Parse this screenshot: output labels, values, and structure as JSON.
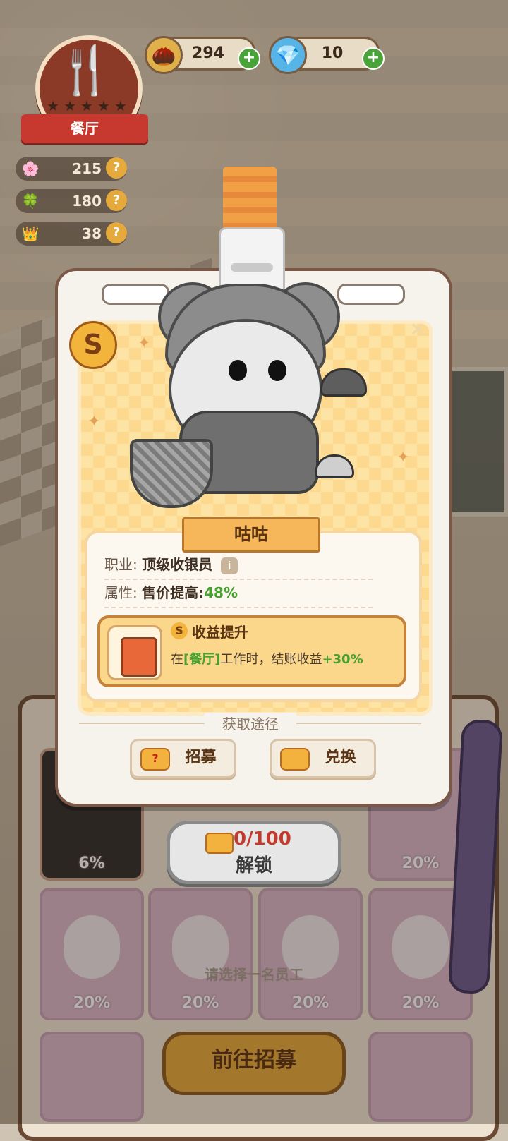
{
  "hud": {
    "building": {
      "label": "餐厅"
    },
    "coins": {
      "value": "294"
    },
    "gems": {
      "value": "10"
    },
    "stats": [
      {
        "icon": "flower-icon",
        "value": "215"
      },
      {
        "icon": "clover-icon",
        "value": "180"
      },
      {
        "icon": "crown-icon",
        "value": "38"
      }
    ],
    "question_mark": "?",
    "plus": "+"
  },
  "card": {
    "grade": "S",
    "close_glyph": "×",
    "name": "咕咕",
    "job_label": "职业:",
    "job_value": "顶级收银员",
    "info_glyph": "i",
    "attr_label": "属性:",
    "attr_value": "售价提高:",
    "attr_pct": "48%",
    "skill": {
      "badge": "S",
      "title": "收益提升",
      "desc_prefix": "在",
      "desc_place": "[餐厅]",
      "desc_mid": "工作时，结账收益",
      "desc_bonus": "+30%"
    },
    "acquire_title": "获取途径",
    "recruit_label": "招募",
    "exchange_label": "兑换"
  },
  "unlock": {
    "count": "0/100",
    "label": "解锁"
  },
  "background": {
    "pct_top_left": "6%",
    "pct_top_right": "20%",
    "row2_pcts": [
      "20%",
      "20%",
      "20%",
      "20%"
    ],
    "hint": "请选择一名员工",
    "go_recruit": "前往招募"
  }
}
